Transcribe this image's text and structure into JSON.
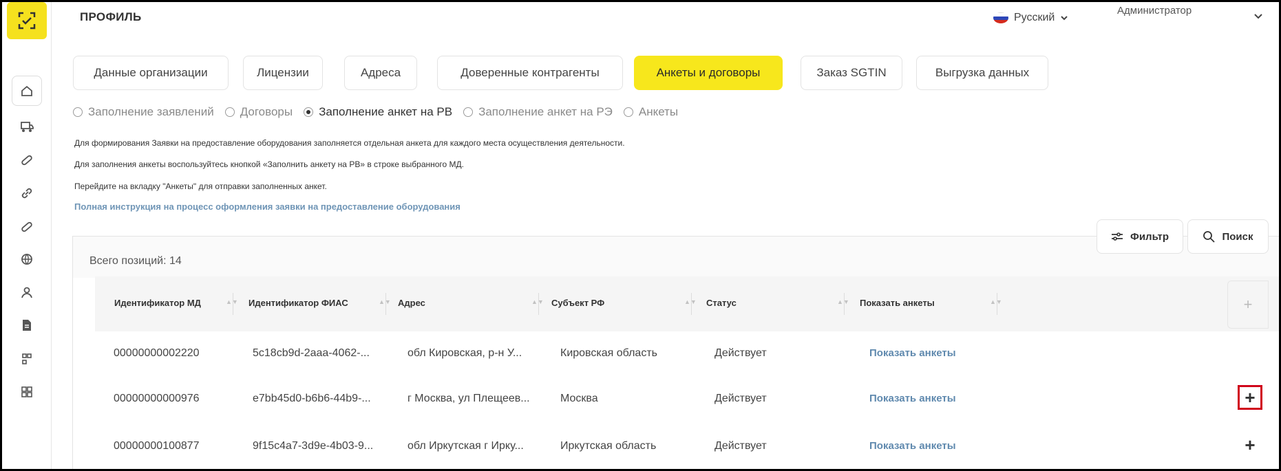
{
  "header": {
    "title": "ПРОФИЛЬ",
    "language": "Русский",
    "user": "Администратор"
  },
  "tabs": [
    {
      "label": "Данные организации",
      "active": false
    },
    {
      "label": "Лицензии",
      "active": false
    },
    {
      "label": "Адреса",
      "active": false
    },
    {
      "label": "Доверенные контрагенты",
      "active": false
    },
    {
      "label": "Анкеты и договоры",
      "active": true
    },
    {
      "label": "Заказ SGTIN",
      "active": false
    },
    {
      "label": "Выгрузка данных",
      "active": false
    }
  ],
  "radios": [
    {
      "label": "Заполнение заявлений",
      "checked": false
    },
    {
      "label": "Договоры",
      "checked": false
    },
    {
      "label": "Заполнение анкет на РВ",
      "checked": true
    },
    {
      "label": "Заполнение анкет на РЭ",
      "checked": false
    },
    {
      "label": "Анкеты",
      "checked": false
    }
  ],
  "info": {
    "line1": "Для формирования Заявки на предоставление оборудования заполняется отдельная анкета для каждого места осуществления деятельности.",
    "line2": "Для заполнения анкеты воспользуйтесь кнопкой «Заполнить анкету на РВ» в строке выбранного МД.",
    "line3": "Перейдите на вкладку \"Анкеты\" для отправки заполненных анкет.",
    "link": "Полная инструкция на процесс оформления заявки на предоставление оборудования"
  },
  "table": {
    "total": "Всего позиций: 14",
    "filter_label": "Фильтр",
    "search_label": "Поиск",
    "columns": [
      "Идентификатор МД",
      "Идентификатор ФИАС",
      "Адрес",
      "Субъект РФ",
      "Статус",
      "Показать анкеты"
    ],
    "rows": [
      {
        "md": "00000000002220",
        "fias": "5c18cb9d-2aaa-4062-...",
        "address": "обл Кировская, р-н У...",
        "region": "Кировская область",
        "status": "Действует",
        "link": "Показать анкеты"
      },
      {
        "md": "00000000000976",
        "fias": "e7bb45d0-b6b6-44b9-...",
        "address": "г Москва, ул Плещеев...",
        "region": "Москва",
        "status": "Действует",
        "link": "Показать анкеты"
      },
      {
        "md": "00000000100877",
        "fias": "9f15c4a7-3d9e-4b03-9...",
        "address": "обл Иркутская г Ирку...",
        "region": "Иркутская область",
        "status": "Действует",
        "link": "Показать анкеты"
      }
    ],
    "add_symbol": "+"
  },
  "colors": {
    "accent": "#f7e71c",
    "link": "#5f89ae",
    "highlight": "#d0021b"
  }
}
